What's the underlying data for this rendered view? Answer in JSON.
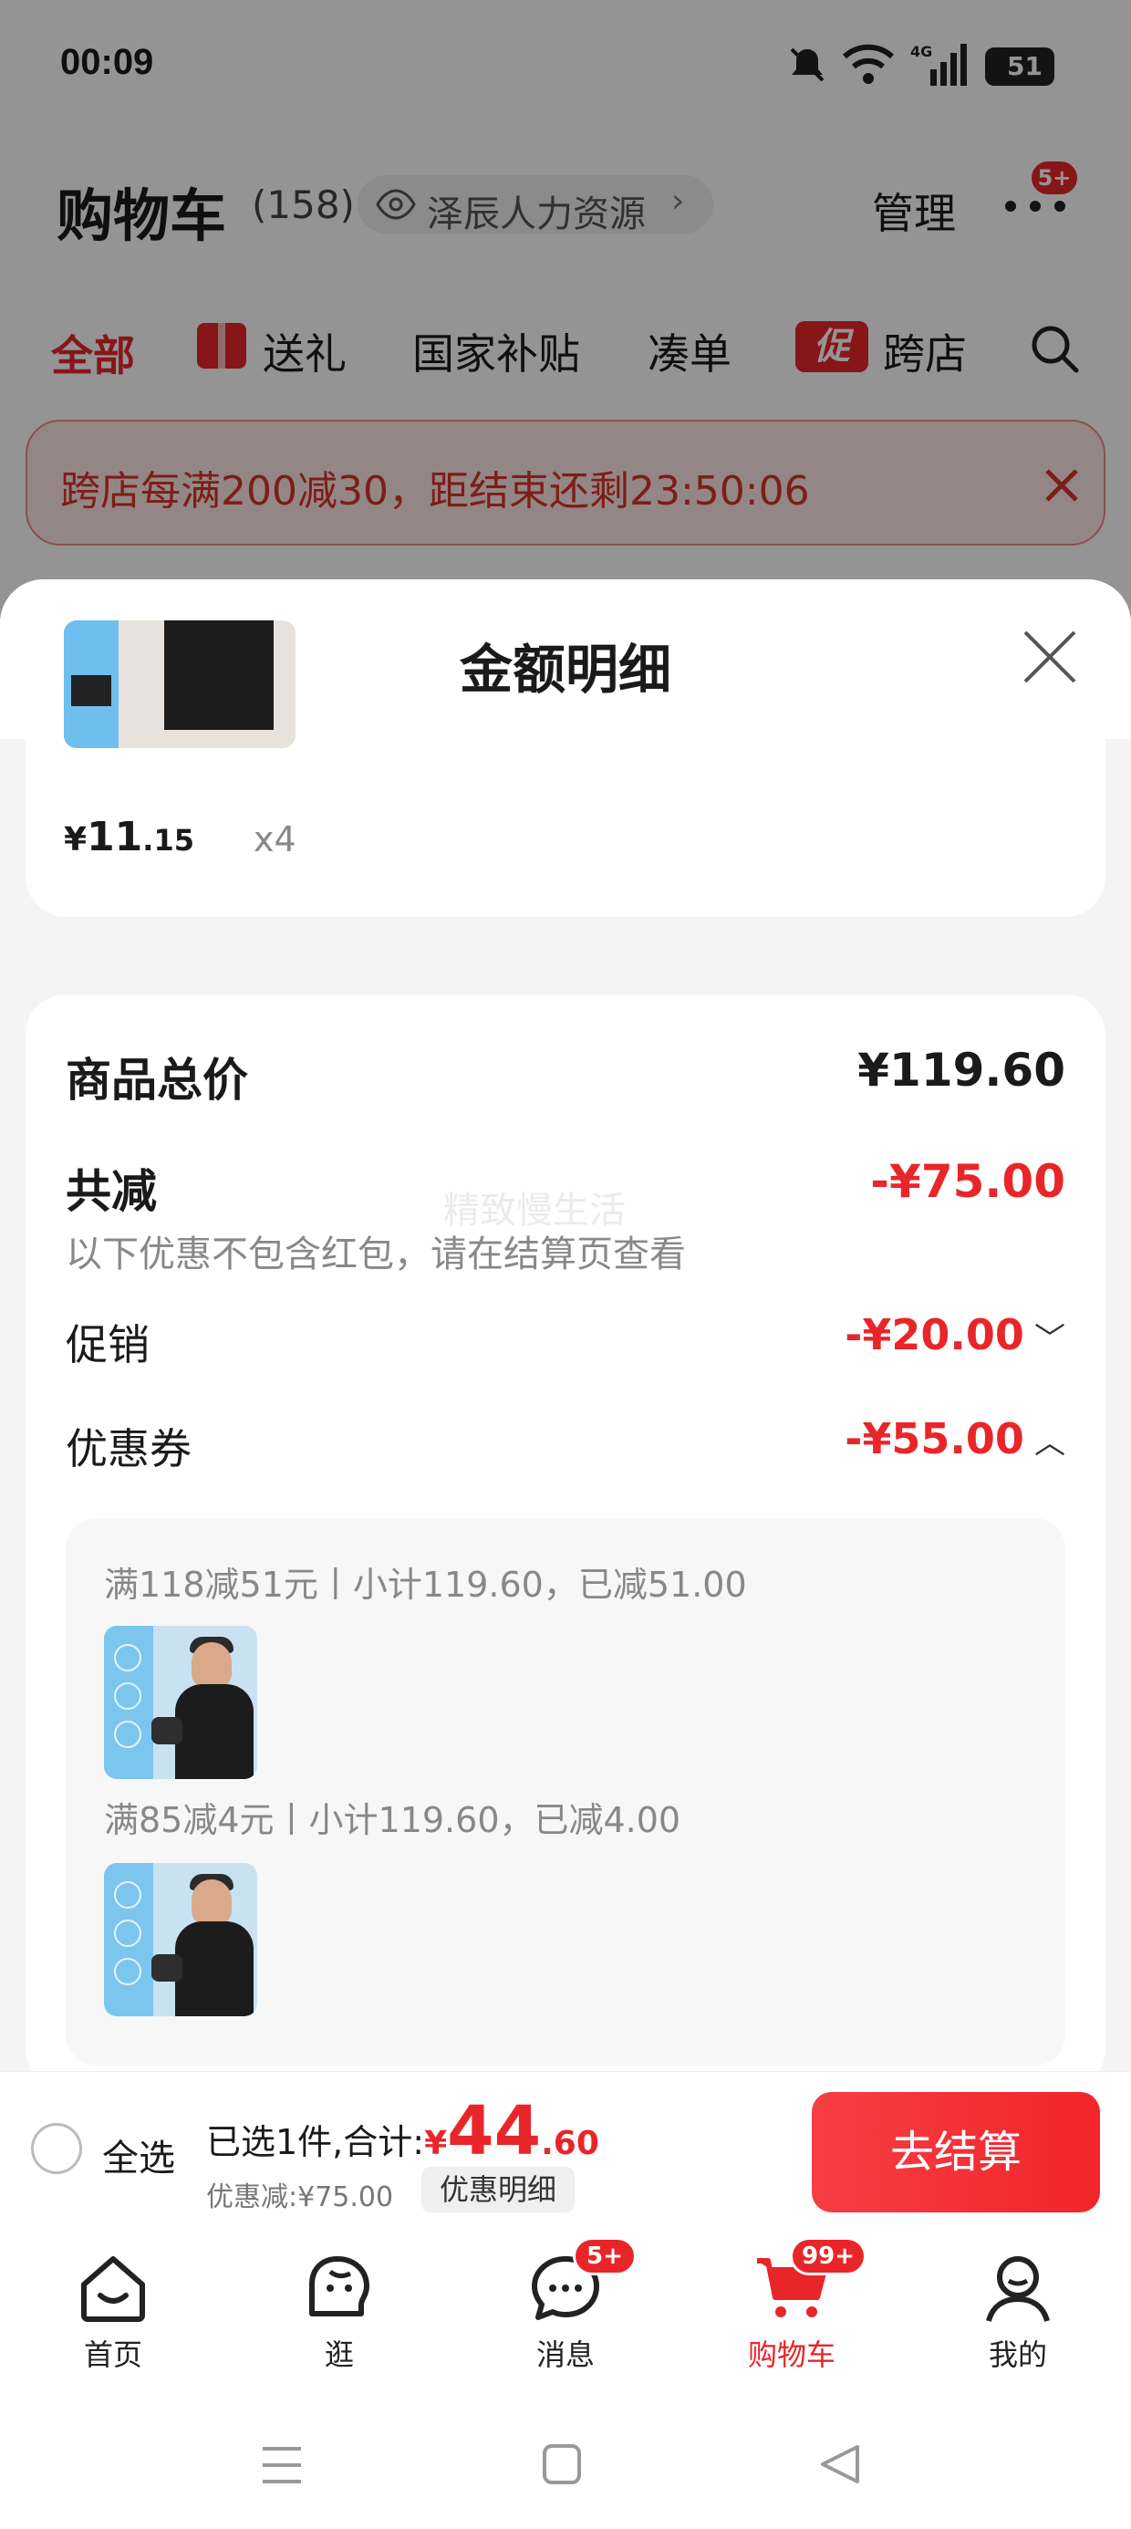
{
  "status_bar": {
    "time": "00:09",
    "battery": "51",
    "signal": "4G"
  },
  "header": {
    "title": "购物车",
    "count": "(158)",
    "address": "泽辰人力资源",
    "manage": "管理",
    "more_badge": "5+"
  },
  "filter_tabs": [
    {
      "label": "全部",
      "active": true
    },
    {
      "label": "送礼"
    },
    {
      "label": "国家补贴"
    },
    {
      "label": "凑单"
    },
    {
      "label": "跨店",
      "tag": "促"
    }
  ],
  "promo_banner": {
    "text": "跨店每满200减30，距结束还剩23:50:06"
  },
  "sheet": {
    "title": "金额明细",
    "top_item": {
      "price_symbol": "¥",
      "price_int": "11",
      "price_dec": ".15",
      "qty": "x4"
    },
    "summary": {
      "total_label": "商品总价",
      "total_value": "¥119.60",
      "discount_label": "共减",
      "discount_value": "-¥75.00",
      "discount_note": "以下优惠不包含红包，请在结算页查看",
      "watermark": "精致慢生活",
      "promo_label": "促销",
      "promo_value": "-¥20.00",
      "coupon_label": "优惠券",
      "coupon_value": "-¥55.00"
    },
    "coupons": [
      {
        "text": "满118减51元丨小计119.60，已减51.00"
      },
      {
        "text": "满85减4元丨小计119.60，已减4.00"
      }
    ]
  },
  "checkout": {
    "select_all": "全选",
    "selected_text": "已选1件,合计:",
    "currency": "¥",
    "total_int": "44",
    "total_dec": ".60",
    "discount_text": "优惠减:¥75.00",
    "detail_button": "优惠明细",
    "checkout_button": "去结算"
  },
  "tabbar": [
    {
      "label": "首页",
      "icon": "home-icon"
    },
    {
      "label": "逛",
      "icon": "browse-icon"
    },
    {
      "label": "消息",
      "icon": "message-icon",
      "badge": "5+"
    },
    {
      "label": "购物车",
      "icon": "cart-icon",
      "badge": "99+",
      "active": true
    },
    {
      "label": "我的",
      "icon": "profile-icon"
    }
  ],
  "colors": {
    "accent": "#e8262a",
    "checkout_button": "#f5333a",
    "banner_bg": "#fde8e6"
  }
}
